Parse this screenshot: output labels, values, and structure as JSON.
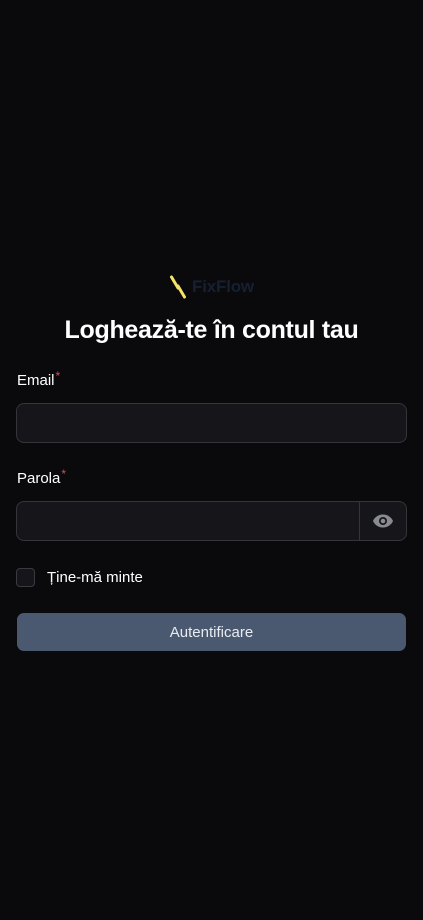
{
  "brand": {
    "name": "FixFlow",
    "accent_color": "#f5e36b",
    "logo_icon": "slash-bolt-icon"
  },
  "form": {
    "title": "Loghează-te în contul tau",
    "email_label": "Email",
    "email_value": "",
    "password_label": "Parola",
    "password_value": "",
    "required_mark": "*",
    "toggle_icon": "eye-icon",
    "remember_label": "Ține-mă minte",
    "remember_checked": false,
    "submit_label": "Autentificare"
  }
}
